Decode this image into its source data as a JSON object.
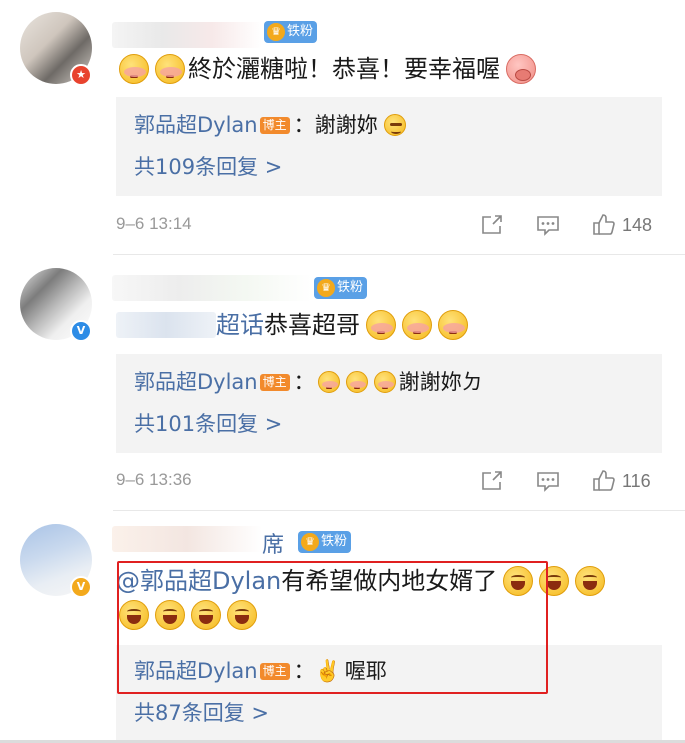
{
  "comments": [
    {
      "avatar_badge": "★",
      "fan_badge": "铁粉",
      "text": "終於灑糖啦！恭喜！要幸福喔",
      "reply": {
        "author": "郭品超Dylan",
        "author_tag": "博主",
        "text": "：謝謝妳"
      },
      "more_replies": "共109条回复 >",
      "timestamp": "9–6 13:14",
      "like_count": "148"
    },
    {
      "avatar_badge": "V",
      "fan_badge": "铁粉",
      "topic_prefix": "超话",
      "text": "恭喜超哥",
      "reply": {
        "author": "郭品超Dylan",
        "author_tag": "博主",
        "text": "謝謝妳ㄉ"
      },
      "more_replies": "共101条回复 >",
      "timestamp": "9–6 13:36",
      "like_count": "116"
    },
    {
      "avatar_badge": "V",
      "name_fragment": "席",
      "fan_badge": "铁粉",
      "mention": "@郭品超Dylan",
      "text": " 有希望做内地女婿了",
      "reply": {
        "author": "郭品超Dylan",
        "author_tag": "博主",
        "emoji": "✌️",
        "text": "喔耶"
      },
      "more_replies": "共87条回复 >"
    }
  ],
  "colors": {
    "link": "#4a6fa5",
    "highlight_frame": "#e02020",
    "reply_bg": "#f3f3f3"
  },
  "icons": {
    "share": "share-icon",
    "comment": "comment-icon",
    "like": "thumbs-up-icon"
  }
}
